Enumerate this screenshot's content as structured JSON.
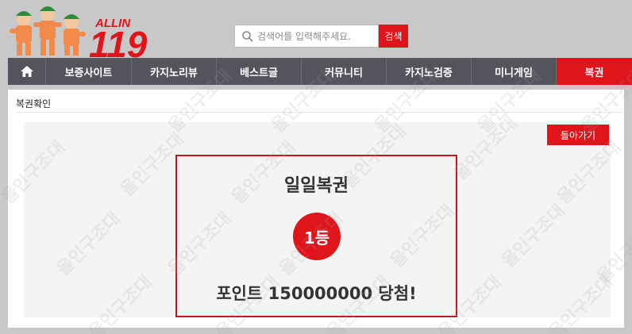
{
  "header": {
    "logo_text": "ALLIN 119",
    "search": {
      "placeholder": "검색어를 입력해주세요.",
      "value": "",
      "button_label": "검색"
    }
  },
  "nav": {
    "items": [
      {
        "label": "보증사이트"
      },
      {
        "label": "카지노리뷰"
      },
      {
        "label": "베스트글"
      },
      {
        "label": "커뮤니티"
      },
      {
        "label": "카지노검증"
      },
      {
        "label": "미니게임"
      },
      {
        "label": "복권",
        "active": true
      }
    ]
  },
  "page": {
    "breadcrumb": "복권확인",
    "back_button_label": "돌아가기"
  },
  "result": {
    "title": "일일복권",
    "rank": "1등",
    "message": "포인트 150000000 당첨!"
  },
  "watermark_text": "올인구조대",
  "colors": {
    "accent": "#e0141b",
    "nav_bg": "#54555c",
    "page_bg": "#c8c8c8"
  }
}
